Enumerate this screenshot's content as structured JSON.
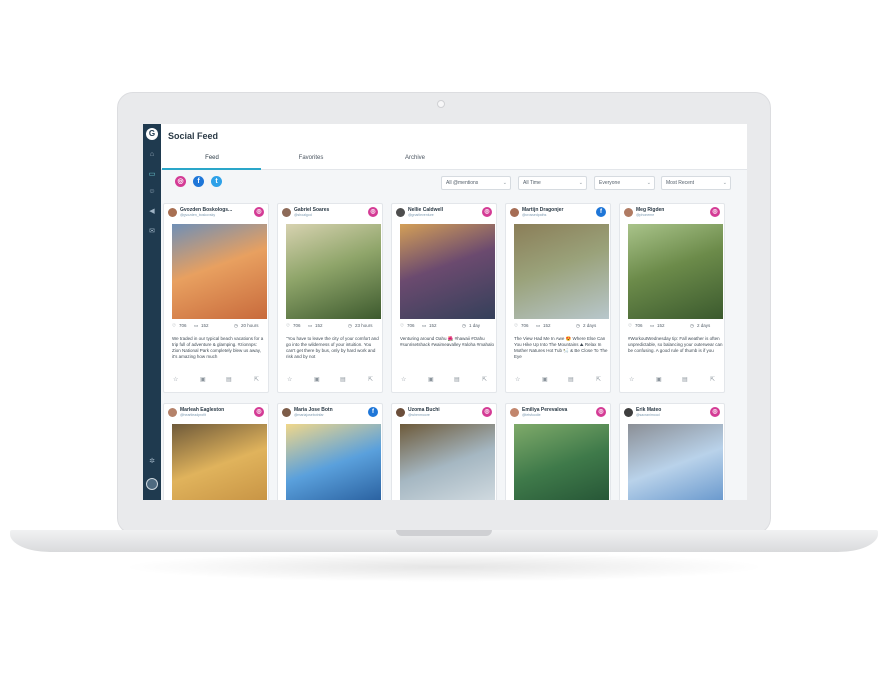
{
  "app": {
    "title": "Social Feed",
    "logo_icon": "gs-logo-icon"
  },
  "sidebar": {
    "icons": [
      "home-icon",
      "feed-icon",
      "users-icon",
      "megaphone-icon",
      "inbox-icon",
      "settings-icon"
    ],
    "active": "feed-icon"
  },
  "tabs": [
    {
      "label": "Feed",
      "active": true
    },
    {
      "label": "Favorites",
      "active": false
    },
    {
      "label": "Archive",
      "active": false
    }
  ],
  "networks": [
    {
      "name": "instagram-icon",
      "glyph": "◎",
      "color": "#d43b95"
    },
    {
      "name": "facebook-icon",
      "glyph": "f",
      "color": "#1e76d8"
    },
    {
      "name": "twitter-icon",
      "glyph": "t",
      "color": "#2ea1e8"
    }
  ],
  "filters": {
    "mentions": "All @mentions",
    "time": "All Time",
    "audience": "Everyone",
    "sort": "Most Recent"
  },
  "posts": [
    {
      "name": "Gvozden Boskologs...",
      "handle": "@gvozden_boskovsky",
      "network": "ig",
      "likes": "706",
      "comments": "152",
      "time": "20 hours",
      "caption": "We traded in our typical beach vacations for a trip full of adventure & glamping. #zionnps: Zion National Park completely blew us away, it's amazing how much",
      "photo": [
        "#c86a3c",
        "#e8a060",
        "#6f8fb6"
      ],
      "avatar": "#a86f52"
    },
    {
      "name": "Gabriel Soares",
      "handle": "@shoalgod",
      "network": "ig",
      "likes": "706",
      "comments": "152",
      "time": "23 hours",
      "caption": "\"You have to leave the city of your comfort and go into the wilderness of your intuition. You can't get there by bus, only by hard work and risk and by not",
      "photo": [
        "#3d5a2e",
        "#8fa56a",
        "#d7d2b0"
      ],
      "avatar": "#8d6a58"
    },
    {
      "name": "Nellie Caldwell",
      "handle": "@gnarlieventure",
      "network": "ig",
      "likes": "706",
      "comments": "152",
      "time": "1 day",
      "caption": "Venturing around Oahu 🌺 #hawaii #Oahu #sunrisetshack #waimeavalley #aloha #mahalo",
      "photo": [
        "#34405a",
        "#6b4a6f",
        "#d39f57"
      ],
      "avatar": "#4e4e4e"
    },
    {
      "name": "Martijn Dragonjer",
      "handle": "@crossedpaths",
      "network": "fb",
      "likes": "706",
      "comments": "152",
      "time": "2 days",
      "caption": "The View Had Me In Awe 😍 Where Else Can You Hike Up Into The Mountains ⛰ Relax In Mother Natures Hot Tub 🛀 & Be Close To The Eye",
      "photo": [
        "#b8c7cc",
        "#9aa27a",
        "#8b7e58"
      ],
      "avatar": "#a66d55"
    },
    {
      "name": "Meg Rigden",
      "handle": "@phoneme",
      "network": "ig",
      "likes": "706",
      "comments": "152",
      "time": "2 days",
      "caption": "#WorkoutWednesday tip: Fall weather is often unpredictable, so balancing your outerwear can be confusing. A good rule of thumb is if you",
      "photo": [
        "#3b5a2e",
        "#6c8b4a",
        "#a9c38a"
      ],
      "avatar": "#b07b63"
    },
    {
      "name": "Marleah Eagleston",
      "handle": "@heartleadprofit",
      "network": "ig",
      "likes": "",
      "comments": "",
      "time": "",
      "caption": "",
      "photo": [
        "#c08a3d",
        "#e0b35c",
        "#6f5a3a"
      ],
      "avatar": "#b5826a"
    },
    {
      "name": "Maria Jose Botn",
      "handle": "@mariajosebotnfar",
      "network": "fb",
      "likes": "",
      "comments": "",
      "time": "",
      "caption": "",
      "photo": [
        "#1a4c8c",
        "#5aa0dc",
        "#f0d78a"
      ],
      "avatar": "#7d5c48"
    },
    {
      "name": "Uzoma Buchi",
      "handle": "@whenmoore",
      "network": "ig",
      "likes": "",
      "comments": "",
      "time": "",
      "caption": "",
      "photo": [
        "#dfe6ea",
        "#a5b7c2",
        "#6d5a3a"
      ],
      "avatar": "#6b4e3a"
    },
    {
      "name": "Emiliya Perevalova",
      "handle": "@letsfoodie",
      "network": "ig",
      "likes": "",
      "comments": "",
      "time": "",
      "caption": "",
      "photo": [
        "#1e4a30",
        "#3f7a4a",
        "#7faa6a"
      ],
      "avatar": "#c2866d"
    },
    {
      "name": "Erik Mateo",
      "handle": "@sacranimood",
      "network": "ig",
      "likes": "",
      "comments": "",
      "time": "",
      "caption": "",
      "photo": [
        "#4f86c4",
        "#b9d2ea",
        "#8b8f96"
      ],
      "avatar": "#3e3e3e"
    }
  ]
}
